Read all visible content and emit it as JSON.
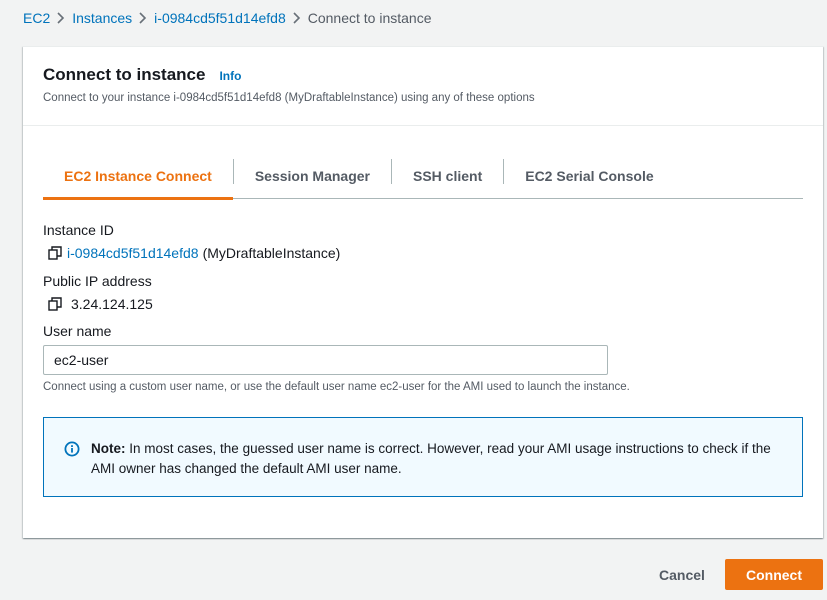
{
  "breadcrumb": {
    "items": [
      "EC2",
      "Instances",
      "i-0984cd5f51d14efd8"
    ],
    "current": "Connect to instance"
  },
  "panel": {
    "title": "Connect to instance",
    "info_label": "Info",
    "description": "Connect to your instance i-0984cd5f51d14efd8 (MyDraftableInstance) using any of these options"
  },
  "tabs": [
    {
      "label": "EC2 Instance Connect",
      "active": true
    },
    {
      "label": "Session Manager",
      "active": false
    },
    {
      "label": "SSH client",
      "active": false
    },
    {
      "label": "EC2 Serial Console",
      "active": false
    }
  ],
  "instance": {
    "label": "Instance ID",
    "id": "i-0984cd5f51d14efd8",
    "name": "(MyDraftableInstance)"
  },
  "public_ip": {
    "label": "Public IP address",
    "value": "3.24.124.125"
  },
  "user_name": {
    "label": "User name",
    "value": "ec2-user",
    "hint": "Connect using a custom user name, or use the default user name ec2-user for the AMI used to launch the instance."
  },
  "note": {
    "prefix": "Note:",
    "text": "In most cases, the guessed user name is correct. However, read your AMI usage instructions to check if the AMI owner has changed the default AMI user name."
  },
  "actions": {
    "cancel": "Cancel",
    "connect": "Connect"
  },
  "colors": {
    "accent": "#ec7211",
    "link": "#0073bb",
    "info_bg": "#f1faff"
  },
  "icons": [
    "chevron-right-icon",
    "copy-icon",
    "info-circle-icon"
  ]
}
